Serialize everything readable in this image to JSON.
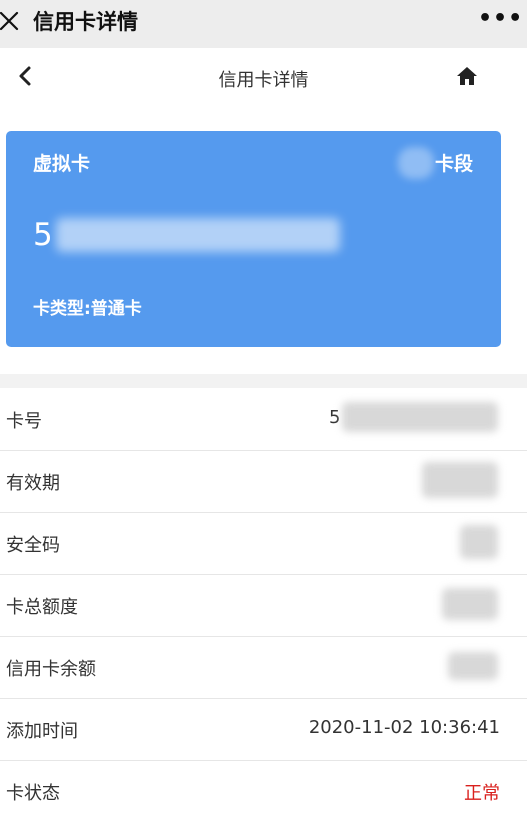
{
  "topbar": {
    "title": "信用卡详情",
    "more": "•••"
  },
  "navbar": {
    "title": "信用卡详情"
  },
  "card": {
    "type": "虚拟卡",
    "segment_label": "卡段",
    "number_prefix": "5",
    "kind": "卡类型:普通卡",
    "background": "#559aee"
  },
  "details": [
    {
      "label": "卡号",
      "value": "5"
    },
    {
      "label": "有效期",
      "value": ""
    },
    {
      "label": "安全码",
      "value": ""
    },
    {
      "label": "卡总额度",
      "value": ""
    },
    {
      "label": "信用卡余额",
      "value": ""
    },
    {
      "label": "添加时间",
      "value": "2020-11-02 10:36:41"
    },
    {
      "label": "卡状态",
      "value": "正常"
    }
  ],
  "colors": {
    "status_ok": "#d9201d",
    "topbar_bg": "#ededed"
  },
  "icons": [
    "close-icon",
    "more-icon",
    "back-arrow-icon",
    "home-icon"
  ]
}
